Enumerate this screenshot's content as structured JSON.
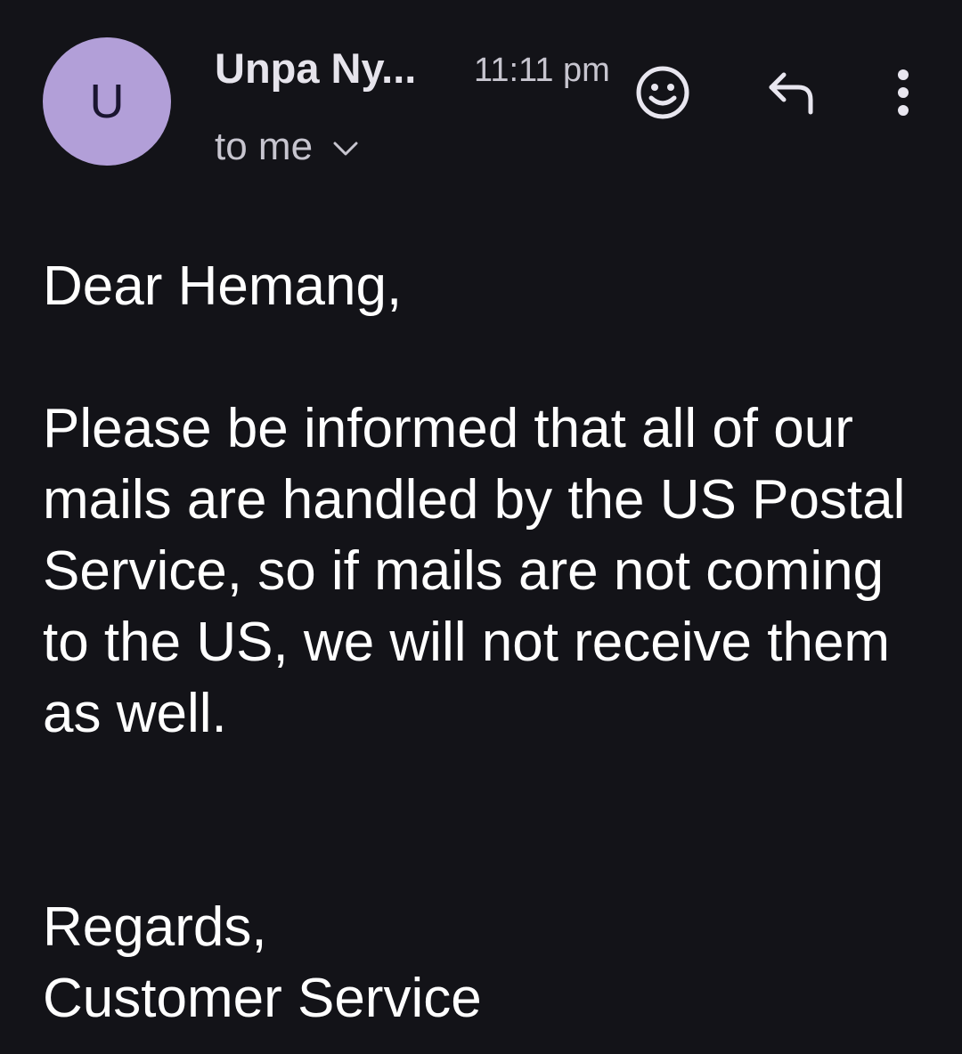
{
  "email": {
    "sender_initial": "U",
    "sender_name": "Unpa Ny...",
    "time": "11:11 pm",
    "recipient": "to me",
    "greeting": "Dear Hemang,",
    "message": "Please be informed that all of our mails are handled by the US Postal Service, so if mails are not coming to the US, we will not receive them as well.",
    "closing": "Regards,",
    "signature": "Customer Service"
  },
  "icons": {
    "avatar": "avatar-initial",
    "emoji": "smiley-icon",
    "reply": "reply-arrow-icon",
    "more": "more-vert-icon",
    "expand": "chevron-down-icon"
  },
  "colors": {
    "background": "#131318",
    "avatar": "#b29fd8",
    "text": "#ffffff",
    "secondary_text": "#c7c5cf"
  }
}
